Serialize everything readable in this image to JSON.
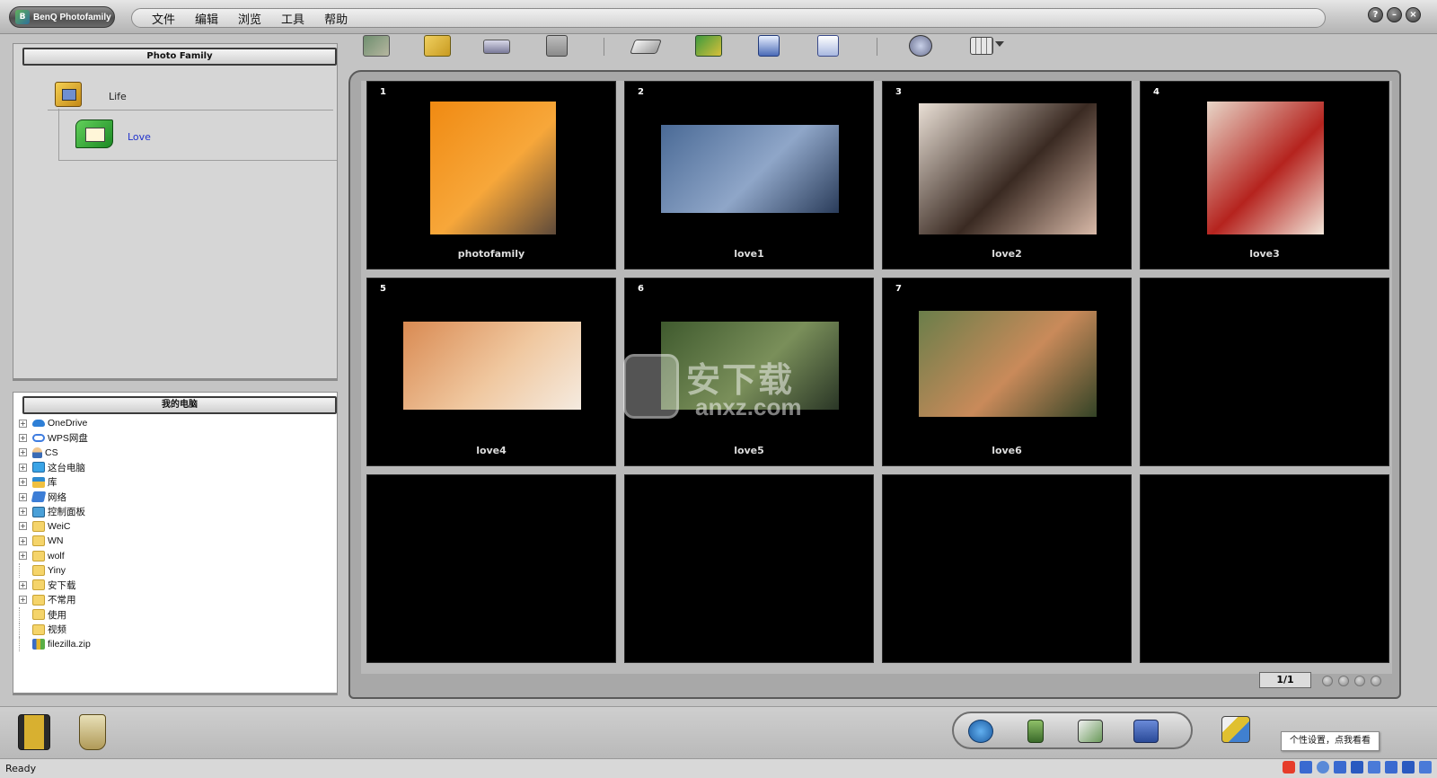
{
  "window": {
    "app_title": "BenQ Photofamily",
    "menu": [
      "文件",
      "编辑",
      "浏览",
      "工具",
      "帮助"
    ],
    "controls": [
      "?",
      "–",
      "×"
    ]
  },
  "family_panel": {
    "header": "Photo Family",
    "albums": [
      {
        "label": "Life",
        "icon": "life-album-icon"
      },
      {
        "label": "Love",
        "icon": "love-album-icon",
        "selected": true
      }
    ]
  },
  "computer_panel": {
    "header": "我的电脑",
    "tree": [
      {
        "label": "OneDrive",
        "icon": "onedrive-icon",
        "expandable": true
      },
      {
        "label": "WPS网盘",
        "icon": "wps-cloud-icon",
        "expandable": true
      },
      {
        "label": "CS",
        "icon": "user-icon",
        "expandable": true
      },
      {
        "label": "这台电脑",
        "icon": "this-pc-icon",
        "expandable": true
      },
      {
        "label": "库",
        "icon": "library-icon",
        "expandable": true
      },
      {
        "label": "网络",
        "icon": "network-icon",
        "expandable": true
      },
      {
        "label": "控制面板",
        "icon": "control-panel-icon",
        "expandable": true
      },
      {
        "label": "WeiC",
        "icon": "folder-icon",
        "expandable": true
      },
      {
        "label": "WN",
        "icon": "folder-icon",
        "expandable": true
      },
      {
        "label": "wolf",
        "icon": "folder-icon",
        "expandable": true
      },
      {
        "label": "Yiny",
        "icon": "folder-icon",
        "expandable": false
      },
      {
        "label": "安下载",
        "icon": "folder-icon",
        "expandable": true
      },
      {
        "label": "不常用",
        "icon": "folder-icon",
        "expandable": true
      },
      {
        "label": "使用",
        "icon": "folder-icon",
        "expandable": false
      },
      {
        "label": "视频",
        "icon": "folder-icon",
        "expandable": false
      },
      {
        "label": "filezilla.zip",
        "icon": "zip-icon",
        "expandable": false
      }
    ]
  },
  "toolbar": {
    "buttons": [
      "import-photo-icon",
      "open-folder-icon",
      "scanner-icon",
      "film-icon",
      "eraser-icon",
      "edit-photo-icon",
      "view-photo-icon",
      "document-icon",
      "magnifier-icon",
      "grid-view-icon"
    ]
  },
  "grid": {
    "cells": [
      {
        "num": "1",
        "caption": "photofamily",
        "colors": [
          "#f08a12",
          "#f7a73a",
          "#5e4a3a"
        ]
      },
      {
        "num": "2",
        "caption": "love1",
        "colors": [
          "#4a6a96",
          "#8fa6c8",
          "#2a3c5a"
        ]
      },
      {
        "num": "3",
        "caption": "love2",
        "colors": [
          "#e9dfd5",
          "#3a2a22",
          "#d8b9a8"
        ]
      },
      {
        "num": "4",
        "caption": "love3",
        "colors": [
          "#e8d6c8",
          "#b5231e",
          "#f2e6da"
        ]
      },
      {
        "num": "5",
        "caption": "love4",
        "colors": [
          "#d98a52",
          "#f0c8a0",
          "#f5ebe0"
        ]
      },
      {
        "num": "6",
        "caption": "love5",
        "colors": [
          "#3f5a2e",
          "#7a8f5a",
          "#2a3626"
        ]
      },
      {
        "num": "7",
        "caption": "love6",
        "colors": [
          "#6a7e4a",
          "#c98a5a",
          "#334326"
        ]
      },
      {
        "num": "",
        "caption": "",
        "colors": []
      },
      {
        "num": "",
        "caption": "",
        "colors": []
      },
      {
        "num": "",
        "caption": "",
        "colors": []
      },
      {
        "num": "",
        "caption": "",
        "colors": []
      },
      {
        "num": "",
        "caption": "",
        "colors": []
      }
    ],
    "page_indicator": "1/1"
  },
  "bottom": {
    "left_icons": [
      "film-roll-icon",
      "trash-bin-icon"
    ],
    "center_icons": [
      "globe-icon",
      "phone-icon",
      "email-photo-icon",
      "fax-icon"
    ],
    "right_icon": "settings-palette-icon",
    "tooltip": "个性设置，点我看看"
  },
  "watermark": {
    "text": "安下载",
    "sub": "anxz.com"
  },
  "status": {
    "text": "Ready"
  }
}
